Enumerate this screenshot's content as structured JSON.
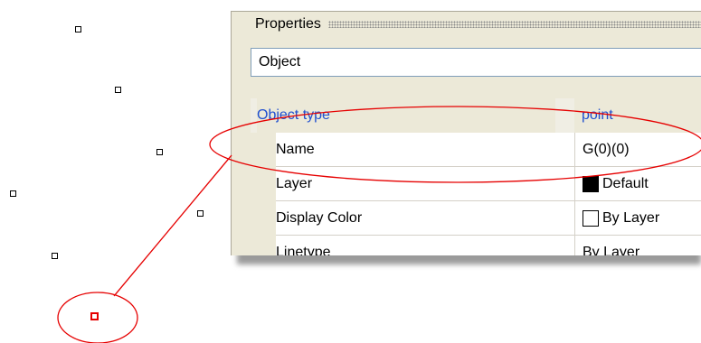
{
  "panel": {
    "title": "Properties",
    "object_selector": "Object",
    "header_row": {
      "label": "Object type",
      "value": "point"
    },
    "rows": [
      {
        "label": "Name",
        "value": "G(0)(0)",
        "swatch": ""
      },
      {
        "label": "Layer",
        "value": "Default",
        "swatch": "#000000"
      },
      {
        "label": "Display Color",
        "value": "By Layer",
        "swatch": "#ffffff"
      },
      {
        "label": "Linetype",
        "value": "By Layer",
        "swatch": ""
      }
    ]
  },
  "canvas": {
    "point_count": 7,
    "selected_point_color": "#e60000",
    "annotation_color": "#e60000"
  }
}
